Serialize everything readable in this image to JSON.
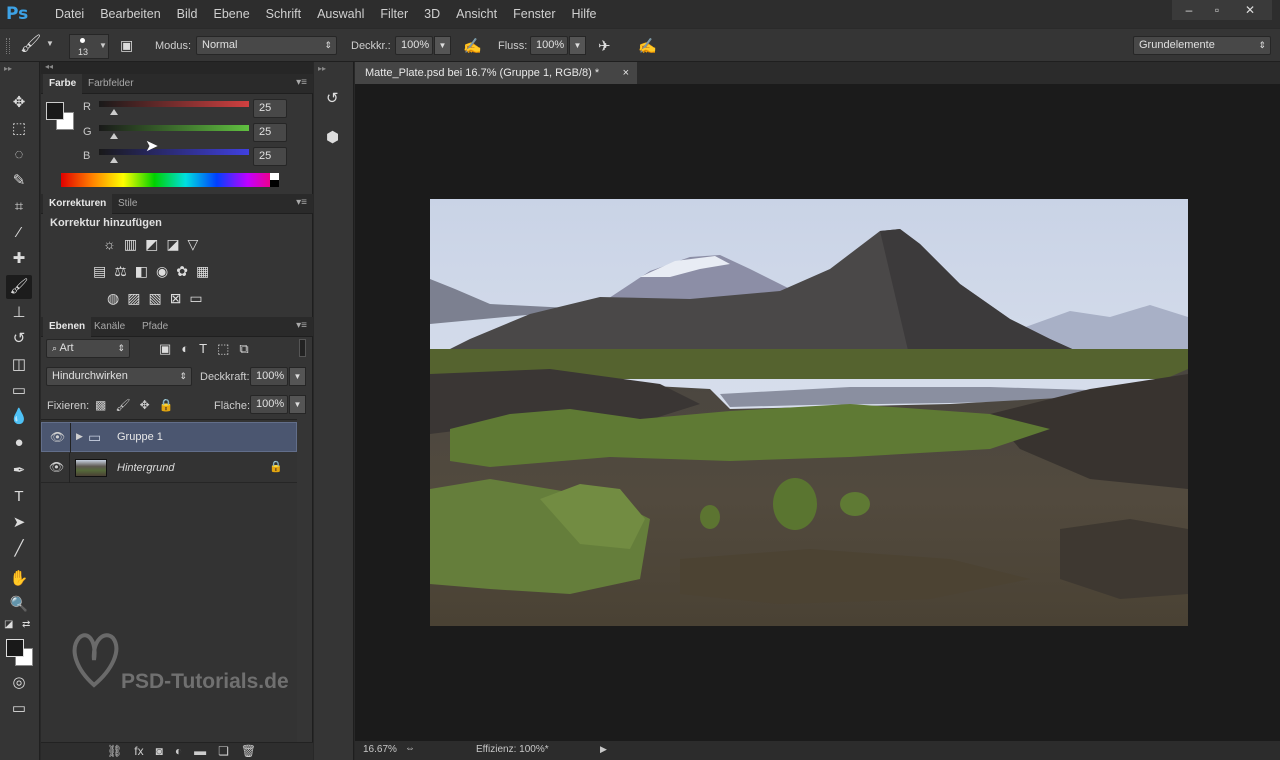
{
  "app": {
    "logo": "Ps",
    "menu": [
      "Datei",
      "Bearbeiten",
      "Bild",
      "Ebene",
      "Schrift",
      "Auswahl",
      "Filter",
      "3D",
      "Ansicht",
      "Fenster",
      "Hilfe"
    ],
    "window_controls": [
      "–",
      "▫",
      "✕"
    ]
  },
  "options": {
    "brush_size": "13",
    "modus_label": "Modus:",
    "modus_value": "Normal",
    "deckkr_label": "Deckkr.:",
    "deckkr_value": "100%",
    "fluss_label": "Fluss:",
    "fluss_value": "100%",
    "workspace": "Grundelemente"
  },
  "color_panel": {
    "tabs": [
      "Farbe",
      "Farbfelder"
    ],
    "channels": [
      {
        "label": "R",
        "value": "25",
        "color": "#d04040"
      },
      {
        "label": "G",
        "value": "25",
        "color": "#50b040"
      },
      {
        "label": "B",
        "value": "25",
        "color": "#4040d0"
      }
    ],
    "slider_level": 0.098
  },
  "adjustments_panel": {
    "tabs": [
      "Korrekturen",
      "Stile"
    ],
    "heading": "Korrektur hinzufügen"
  },
  "layers_panel": {
    "tabs": [
      "Ebenen",
      "Kanäle",
      "Pfade"
    ],
    "filter": "Art",
    "blend_mode": "Hindurchwirken",
    "opacity_label": "Deckkraft:",
    "opacity_value": "100%",
    "lock_label": "Fixieren:",
    "fill_label": "Fläche:",
    "fill_value": "100%",
    "layers": [
      {
        "name": "Gruppe 1",
        "type": "group",
        "selected": true
      },
      {
        "name": "Hintergrund",
        "type": "image",
        "locked": true
      }
    ]
  },
  "watermark": "PSD-Tutorials.de",
  "document": {
    "tab_title": "Matte_Plate.psd bei 16.7% (Gruppe 1, RGB/8) *",
    "close": "×"
  },
  "status": {
    "zoom": "16.67%",
    "info": "Effizienz: 100%*"
  }
}
